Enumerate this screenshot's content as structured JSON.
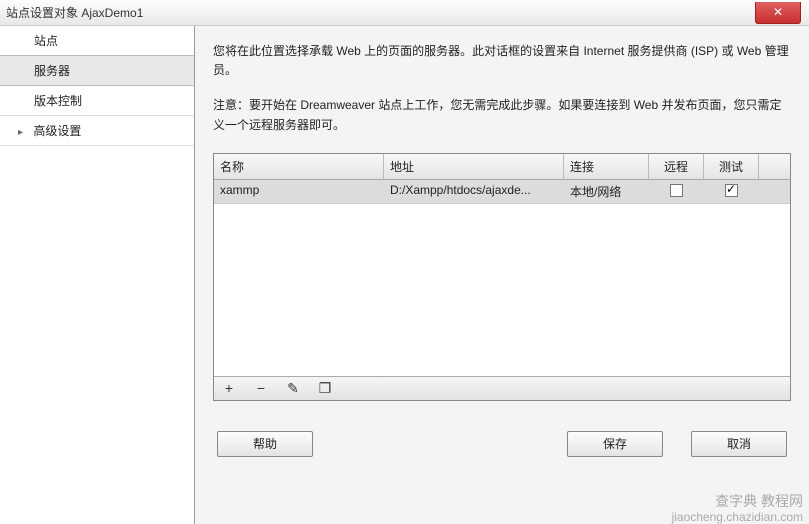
{
  "window": {
    "title": "站点设置对象 AjaxDemo1"
  },
  "sidebar": {
    "items": [
      {
        "label": "站点",
        "expandable": false
      },
      {
        "label": "服务器",
        "expandable": false,
        "selected": true
      },
      {
        "label": "版本控制",
        "expandable": false
      },
      {
        "label": "高级设置",
        "expandable": true
      }
    ]
  },
  "content": {
    "description": "您将在此位置选择承载 Web 上的页面的服务器。此对话框的设置来自 Internet 服务提供商 (ISP) 或 Web 管理员。",
    "note": "注意：要开始在 Dreamweaver 站点上工作，您无需完成此步骤。如果要连接到 Web 并发布页面，您只需定义一个远程服务器即可。"
  },
  "table": {
    "headers": {
      "name": "名称",
      "address": "地址",
      "connection": "连接",
      "remote": "远程",
      "test": "测试"
    },
    "rows": [
      {
        "name": "xammp",
        "address": "D:/Xampp/htdocs/ajaxde...",
        "connection": "本地/网络",
        "remote": false,
        "test": true
      }
    ]
  },
  "toolbar": {
    "add": "+",
    "remove": "−",
    "edit": "✎",
    "duplicate": "❐"
  },
  "buttons": {
    "help": "帮助",
    "save": "保存",
    "cancel": "取消"
  },
  "watermark": {
    "line1": "查字典 教程网",
    "line2": "jiaocheng.chazidian.com"
  }
}
